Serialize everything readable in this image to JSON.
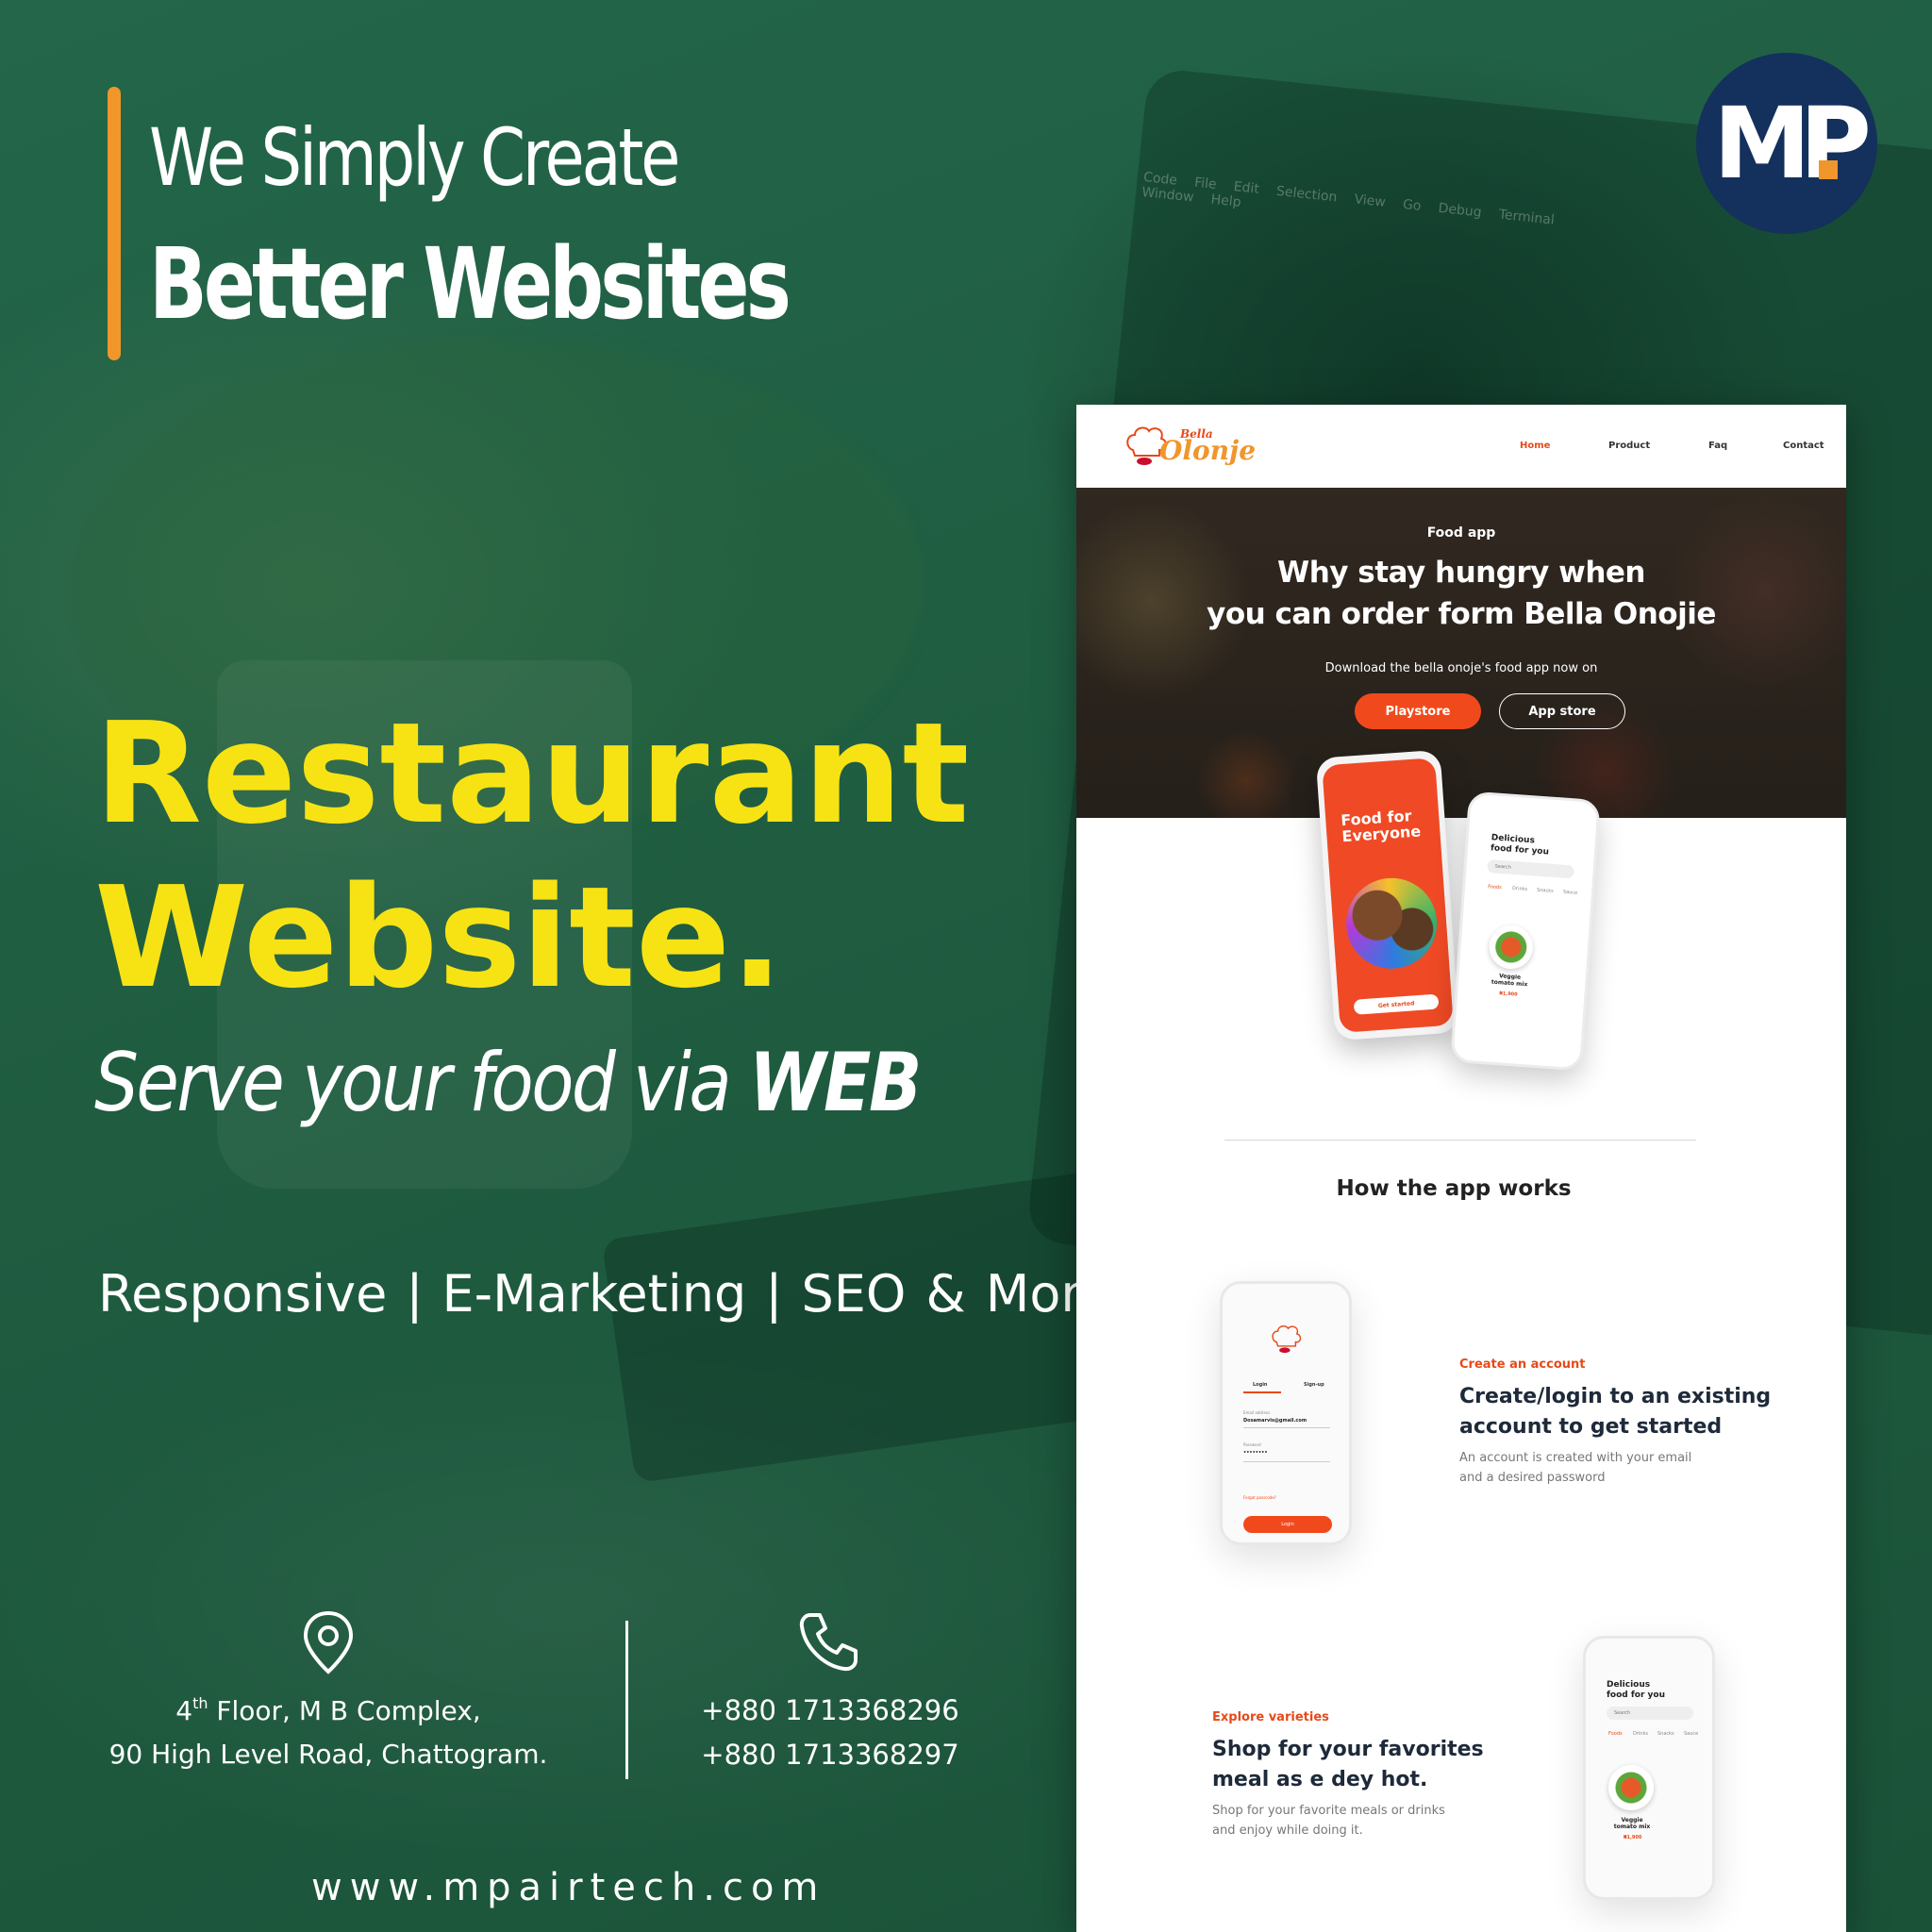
{
  "tagline": {
    "line1": "We Simply Create",
    "line2": "Better Websites"
  },
  "headline": {
    "line1": "Restaurant",
    "line2": "Website."
  },
  "subheadline": {
    "prefix": "Serve your food via ",
    "emphasis": "WEB"
  },
  "services": {
    "items": [
      "Responsive",
      "E-Marketing",
      "SEO & More"
    ],
    "separator": "|"
  },
  "contact": {
    "address_floor_num": "4",
    "address_floor_sup": "th",
    "address_line1_rest": " Floor, M B Complex,",
    "address_line2": "90 High Level Road, Chattogram.",
    "phones": [
      "+880 1713368296",
      "+880 1713368297"
    ],
    "website": "www.mpairtech.com"
  },
  "logo": {
    "text": "MP"
  },
  "background_text": {
    "laptop_menu": "Code File Edit Selection View Go Debug Terminal Window Help"
  },
  "mockup": {
    "brand": {
      "small": "Bella",
      "large": "Olonje"
    },
    "nav": [
      "Home",
      "Product",
      "Faq",
      "Contact"
    ],
    "active_nav": "Home",
    "hero": {
      "tag": "Food app",
      "title_line1": "Why stay hungry when",
      "title_line2": "you can order form Bella Onojie",
      "subtitle": "Download the bella onoje's food app now on",
      "buttons": {
        "playstore": "Playstore",
        "appstore": "App store"
      }
    },
    "phone_red": {
      "title_line1": "Food for",
      "title_line2": "Everyone",
      "cta": "Get started"
    },
    "phone_white": {
      "title_line1": "Delicious",
      "title_line2": "food for you",
      "search": "Search",
      "tabs": [
        "Foods",
        "Drinks",
        "Snacks",
        "Sauce"
      ],
      "item_name": "Veggie tomato mix",
      "item_price": "₦1,900"
    },
    "section_title": "How the app works",
    "step1": {
      "label": "Create an account",
      "title_line1": "Create/login to an existing",
      "title_line2": "account to get started",
      "desc_line1": "An account is created with your email",
      "desc_line2": "and a desired password",
      "phone": {
        "tab_login": "Login",
        "tab_signup": "Sign-up",
        "email_label": "Email address",
        "email_value": "Dosamarvis@gmail.com",
        "password_label": "Password",
        "password_value": "••••••••",
        "forgot": "Forgot passcode?",
        "button": "Login"
      }
    },
    "step2": {
      "label": "Explore varieties",
      "title_line1": "Shop for your favorites",
      "title_line2": "meal as e dey hot.",
      "desc_line1": "Shop for your favorite meals or drinks",
      "desc_line2": "and enjoy while doing it.",
      "phone": {
        "title_line1": "Delicious",
        "title_line2": "food for you",
        "search": "Search",
        "tabs": [
          "Foods",
          "Drinks",
          "Snacks",
          "Sauce"
        ],
        "item_name": "Veggie tomato mix",
        "item_price": "₦1,900"
      }
    }
  },
  "colors": {
    "background": "#1e5a3a",
    "accent_orange": "#f0962b",
    "headline_yellow": "#f7e314",
    "logo_navy": "#14305c",
    "mock_primary": "#f04a1c"
  },
  "icons": [
    "location-pin-icon",
    "phone-icon",
    "chef-hat-icon"
  ]
}
